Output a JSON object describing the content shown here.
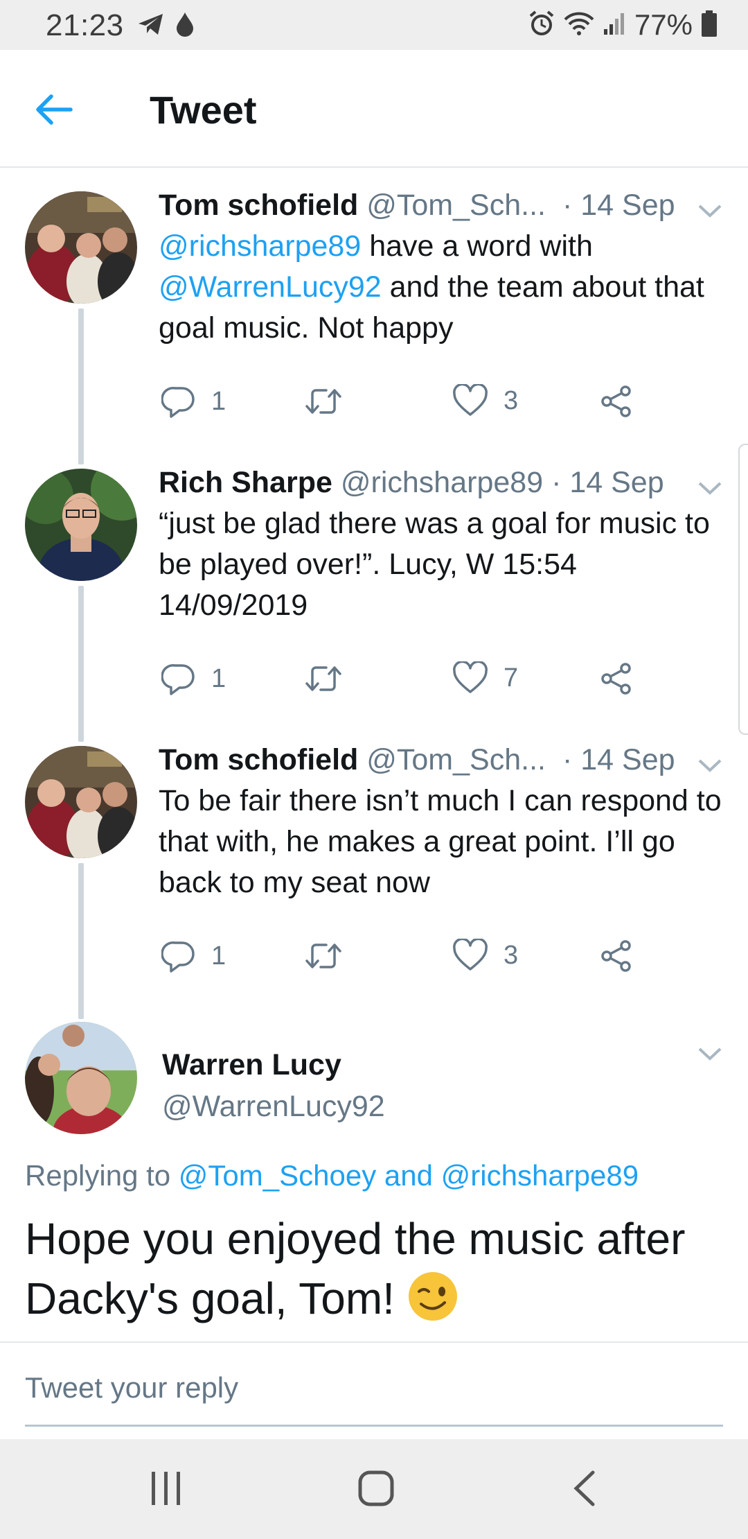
{
  "status_bar": {
    "time": "21:23",
    "battery": "77%",
    "icons": [
      "telegram-icon",
      "drop-icon",
      "alarm-icon",
      "wifi-icon",
      "signal-icon",
      "battery-icon"
    ]
  },
  "header": {
    "title": "Tweet",
    "back_icon": "arrow-left-icon"
  },
  "thread": [
    {
      "name": "Tom schofield",
      "handle": "@Tom_Sch...",
      "date": "· 14 Sep",
      "body": [
        {
          "t": "@richsharpe89",
          "m": true
        },
        {
          "t": " have a word with ",
          "m": false
        },
        {
          "t": "@WarrenLucy92",
          "m": true
        },
        {
          "t": " and the team about that goal music. Not happy",
          "m": false
        }
      ],
      "replies": "1",
      "retweets": "",
      "likes": "3"
    },
    {
      "name": "Rich Sharpe",
      "handle": "@richsharpe89",
      "date": "· 14 Sep",
      "body": [
        {
          "t": "“just be glad there was a goal for music to be played over!”. Lucy, W 15:54 14/09/2019",
          "m": false
        }
      ],
      "replies": "1",
      "retweets": "",
      "likes": "7"
    },
    {
      "name": "Tom schofield",
      "handle": "@Tom_Sch...",
      "date": "· 14 Sep",
      "body": [
        {
          "t": "To be fair there isn’t much I can respond to that with, he makes a great point. I’ll go back to my seat now",
          "m": false
        }
      ],
      "replies": "1",
      "retweets": "",
      "likes": "3"
    }
  ],
  "main_tweet": {
    "name": "Warren Lucy",
    "handle": "@WarrenLucy92",
    "replying_prefix": "Replying to ",
    "replying_user1": "@Tom_Schoey",
    "replying_and": " and ",
    "replying_user2": "@richsharpe89",
    "text": "Hope you enjoyed the music after Dacky's goal, Tom! ",
    "emoji": "😉"
  },
  "reply": {
    "placeholder": "Tweet your reply"
  },
  "colors": {
    "accent": "#1da1f2",
    "muted": "#657786",
    "text": "#14171a",
    "thread_line": "#cdd6dd"
  }
}
